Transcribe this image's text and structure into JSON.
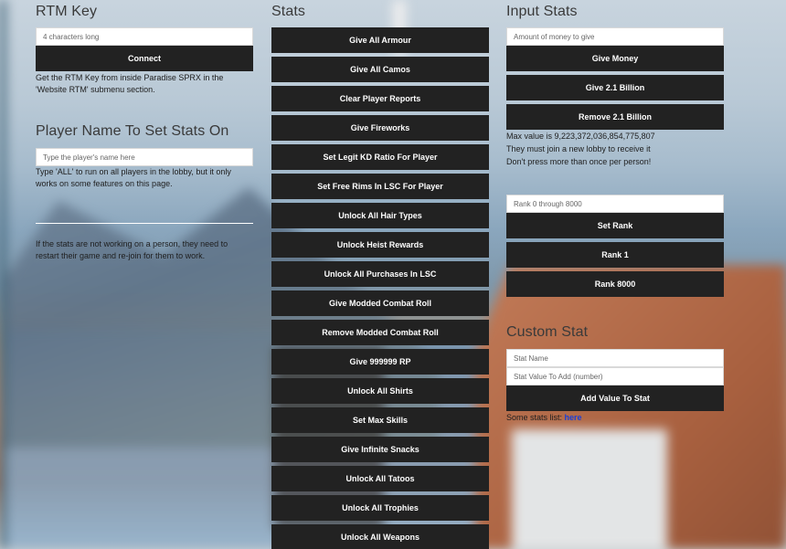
{
  "rtm": {
    "title": "RTM Key",
    "key_placeholder": "4 characters long",
    "connect_label": "Connect",
    "help": "Get the RTM Key from inside Paradise SPRX in the 'Website RTM' submenu section."
  },
  "player": {
    "title": "Player Name To Set Stats On",
    "name_placeholder": "Type the player's name here",
    "help": "Type 'ALL' to run on all players in the lobby, but it only works on some features on this page.",
    "restart_note": "If the stats are not working on a person, they need to restart their game and re-join for them to work."
  },
  "stats": {
    "title": "Stats",
    "buttons": [
      "Give All Armour",
      "Give All Camos",
      "Clear Player Reports",
      "Give Fireworks",
      "Set Legit KD Ratio For Player",
      "Set Free Rims In LSC For Player",
      "Unlock All Hair Types",
      "Unlock Heist Rewards",
      "Unlock All Purchases In LSC",
      "Give Modded Combat Roll",
      "Remove Modded Combat Roll",
      "Give 999999 RP",
      "Unlock All Shirts",
      "Set Max Skills",
      "Give Infinite Snacks",
      "Unlock All Tatoos",
      "Unlock All Trophies",
      "Unlock All Weapons"
    ]
  },
  "input_stats": {
    "title": "Input Stats",
    "money_placeholder": "Amount of money to give",
    "give_money": "Give Money",
    "give_billion": "Give 2.1 Billion",
    "remove_billion": "Remove 2.1 Billion",
    "note_max": "Max value is 9,223,372,036,854,775,807",
    "note_lobby": "They must join a new lobby to receive it",
    "note_once": "Don't press more than once per person!",
    "rank_placeholder": "Rank 0 through 8000",
    "set_rank": "Set Rank",
    "rank_1": "Rank 1",
    "rank_8000": "Rank 8000"
  },
  "custom_stat": {
    "title": "Custom Stat",
    "name_placeholder": "Stat Name",
    "value_placeholder": "Stat Value To Add (number)",
    "add_label": "Add Value To Stat",
    "list_prefix": "Some stats list:",
    "list_link": "here"
  }
}
